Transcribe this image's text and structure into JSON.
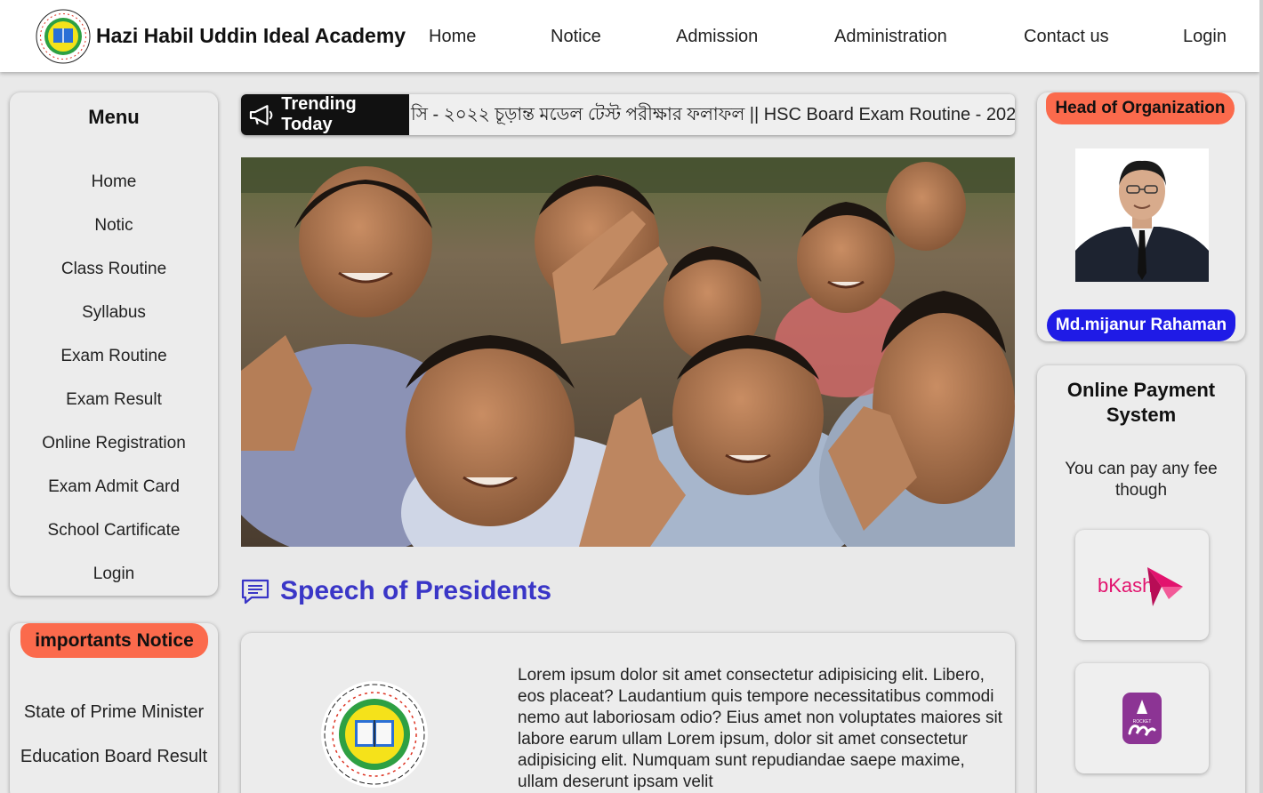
{
  "header": {
    "brand": "Hazi Habil Uddin Ideal Academy",
    "nav": [
      "Home",
      "Notice",
      "Admission",
      "Administration",
      "Contact us",
      "Login"
    ]
  },
  "menu": {
    "title": "Menu",
    "items": [
      "Home",
      "Notic",
      "Class Routine",
      "Syllabus",
      "Exam Routine",
      "Exam Result",
      "Online Registration",
      "Exam Admit Card",
      "School Cartificate",
      "Login"
    ]
  },
  "notice": {
    "title": "importants Notice",
    "items": [
      "State of Prime Minister",
      "Education Board Result"
    ]
  },
  "trending": {
    "label": "Trending Today",
    "text": "সি - ২০২২ চূড়ান্ত মডেল টেস্ট পরীক্ষার ফলাফল || HSC Board Exam Routine - 202"
  },
  "speech": {
    "title": "Speech of Presidents",
    "body": "Lorem ipsum dolor sit amet consectetur adipisicing elit. Libero, eos placeat? Laudantium quis tempore necessitatibus commodi nemo aut laboriosam odio? Eius amet non voluptates maiores sit labore earum ullam Lorem ipsum, dolor sit amet consectetur adipisicing elit. Numquam sunt repudiandae saepe maxime, ullam deserunt ipsam velit"
  },
  "head": {
    "title": "Head of Organization",
    "name": "Md.mijanur Rahaman"
  },
  "payment": {
    "title": "Online Payment System",
    "description": "You can pay any fee though",
    "bkash_label": "bKash",
    "rocket_label": "ROCKET"
  },
  "colors": {
    "accent_orange": "#fb6a4c",
    "accent_blue": "#1f1be6",
    "speech_title": "#3a36c7",
    "bkash": "#e2136e",
    "rocket": "#8c3494"
  }
}
